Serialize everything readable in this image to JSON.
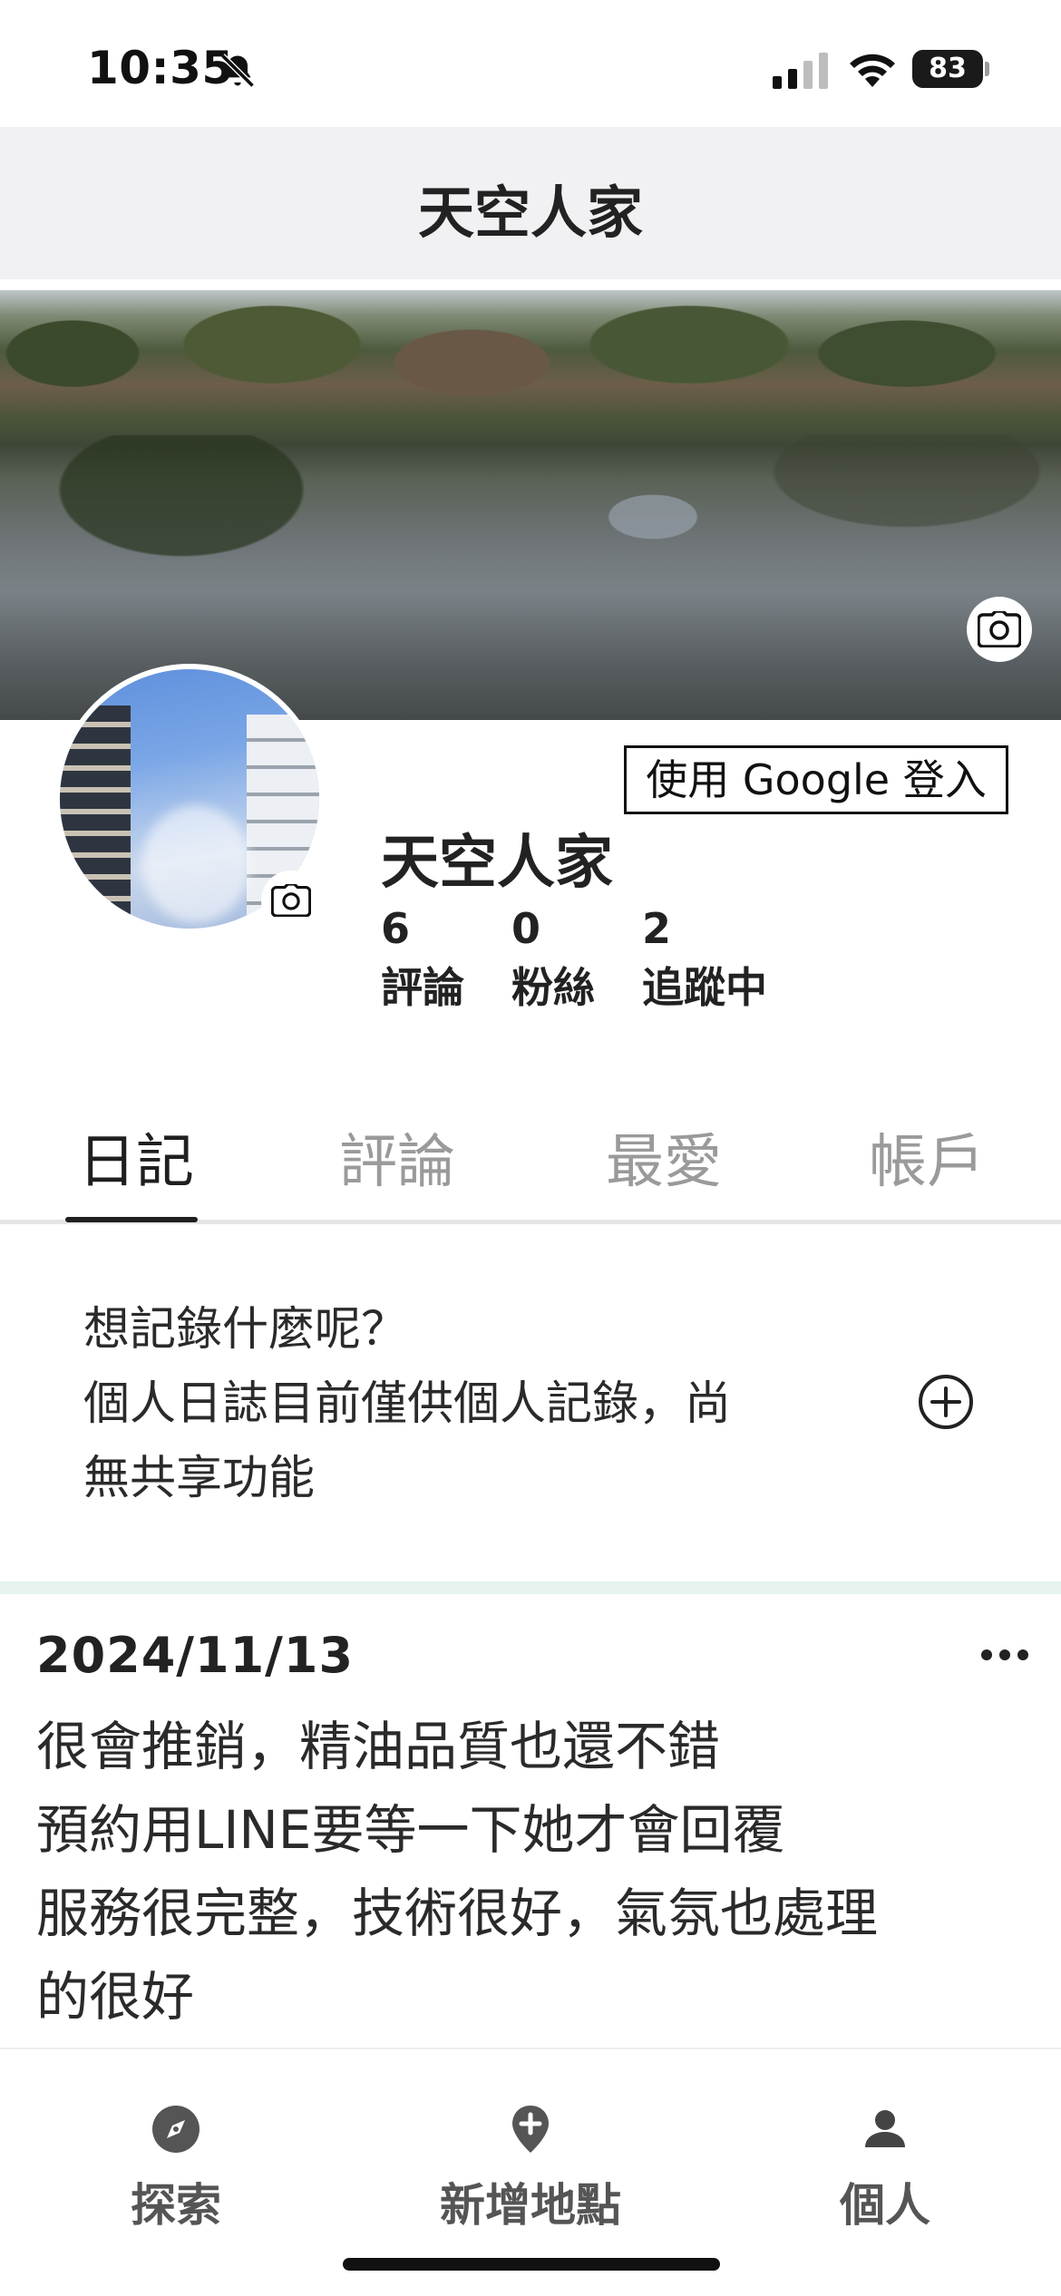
{
  "status_bar": {
    "time": "10:35",
    "battery": "83",
    "battery_level": 0.83,
    "icons": [
      "bell-slash-icon",
      "cellular-signal-icon",
      "wifi-icon",
      "battery-icon"
    ]
  },
  "header": {
    "title": "天空人家"
  },
  "profile": {
    "google_login_label": "使用 Google 登入",
    "name": "天空人家",
    "stats": [
      {
        "value": "6",
        "label": "評論"
      },
      {
        "value": "0",
        "label": "粉絲"
      },
      {
        "value": "2",
        "label": "追蹤中"
      }
    ]
  },
  "tabs": [
    {
      "label": "日記",
      "active": true
    },
    {
      "label": "評論",
      "active": false
    },
    {
      "label": "最愛",
      "active": false
    },
    {
      "label": "帳戶",
      "active": false
    }
  ],
  "journal_prompt": {
    "line1": "想記錄什麼呢？",
    "line2": "個人日誌目前僅供個人記錄，尚",
    "line3": "無共享功能"
  },
  "entries": [
    {
      "date": "2024/11/13",
      "lines": [
        "很會推銷，精油品質也還不錯",
        "預約用LINE要等一下她才會回覆",
        "服務很完整，技術很好，氣氛也處理",
        "的很好"
      ]
    }
  ],
  "bottom_nav": [
    {
      "label": "探索",
      "icon": "compass-icon"
    },
    {
      "label": "新增地點",
      "icon": "add-location-icon"
    },
    {
      "label": "個人",
      "icon": "person-icon",
      "active": true
    }
  ],
  "colors": {
    "accent_pill": "#8dd3bd",
    "header_bg": "#f1f1f4",
    "divider_band": "#e6f3ef"
  }
}
